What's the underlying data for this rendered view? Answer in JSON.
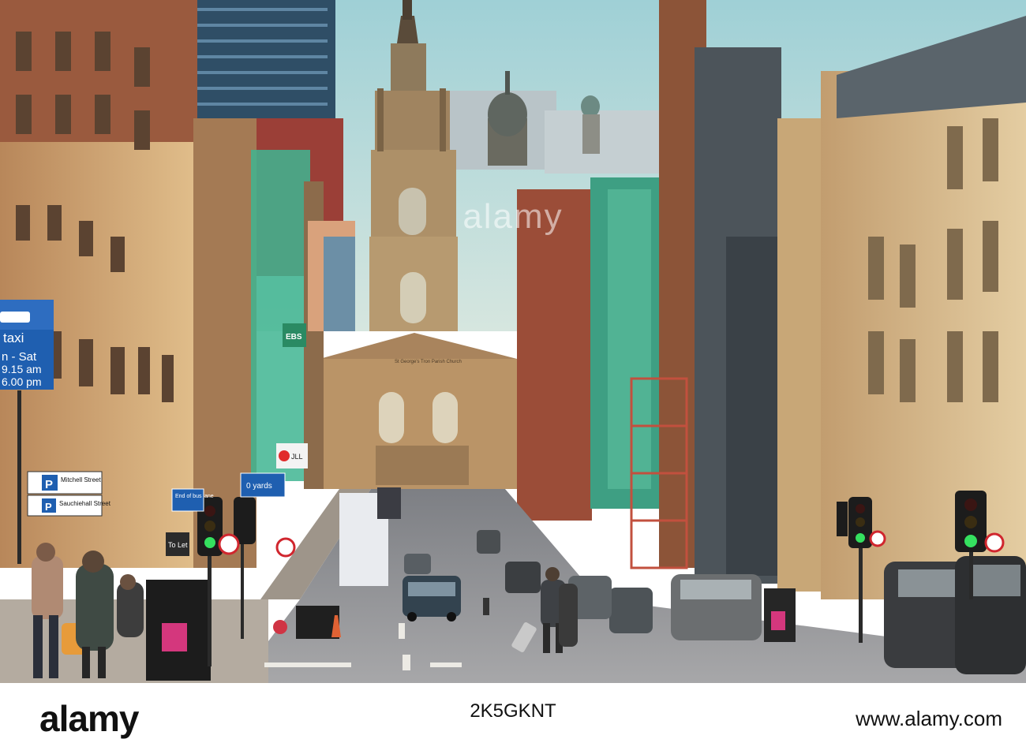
{
  "watermark": "alamy",
  "footer": {
    "logo": "alamy",
    "image_id": "2K5GKNT",
    "site": "www.alamy.com"
  },
  "signs": {
    "taxi": "taxi",
    "days": "n - Sat",
    "time1": "9.15 am",
    "time2": "6.00 pm",
    "mitchell": "Mitchell Street",
    "sauchiehall": "Sauchiehall Street",
    "parking": "P",
    "bus_lane": "End of bus lane",
    "yards": "0 yards",
    "to_let": "To Let",
    "ebs": "EBS",
    "jll": "JLL",
    "church": "St George's Tron Parish Church"
  },
  "colors": {
    "sky": "#a9d3d6",
    "sandstone": "#c9a677",
    "redstone": "#8f4a35",
    "road": "#8d8f93",
    "sign_blue": "#1f5fb0"
  }
}
